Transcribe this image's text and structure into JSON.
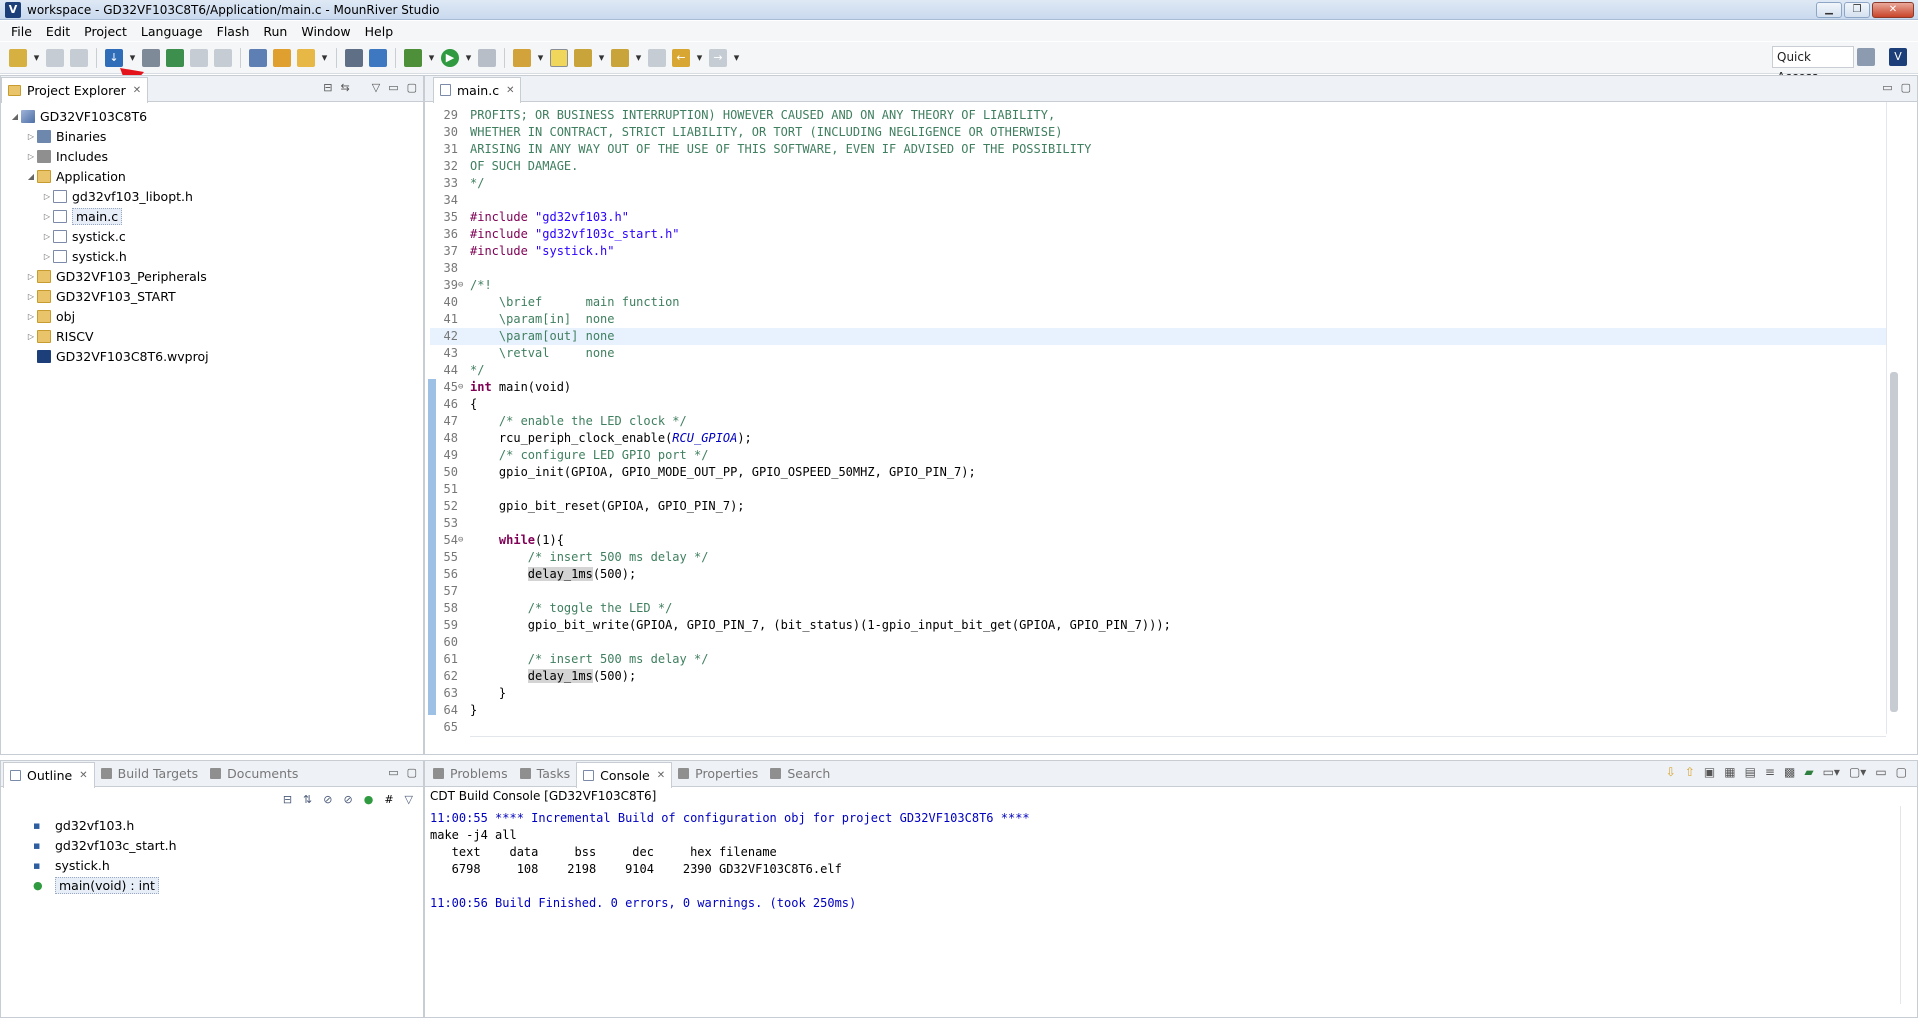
{
  "window": {
    "title": "workspace - GD32VF103C8T6/Application/main.c - MounRiver Studio"
  },
  "menu": [
    "File",
    "Edit",
    "Project",
    "Language",
    "Flash",
    "Run",
    "Window",
    "Help"
  ],
  "toolbar": {
    "quick_access": "Quick Access"
  },
  "project_explorer": {
    "title": "Project Explorer",
    "nodes": [
      {
        "label": "GD32VF103C8T6",
        "depth": 0,
        "twisty": "open",
        "icon": "project-icon"
      },
      {
        "label": "Binaries",
        "depth": 1,
        "twisty": "closed",
        "icon": "binaries-icon"
      },
      {
        "label": "Includes",
        "depth": 1,
        "twisty": "closed",
        "icon": "includes-icon"
      },
      {
        "label": "Application",
        "depth": 1,
        "twisty": "open",
        "icon": "folder-icon"
      },
      {
        "label": "gd32vf103_libopt.h",
        "depth": 2,
        "twisty": "closed",
        "icon": "header-file-icon"
      },
      {
        "label": "main.c",
        "depth": 2,
        "twisty": "closed",
        "icon": "c-file-icon",
        "selected": true
      },
      {
        "label": "systick.c",
        "depth": 2,
        "twisty": "closed",
        "icon": "c-file-icon"
      },
      {
        "label": "systick.h",
        "depth": 2,
        "twisty": "closed",
        "icon": "header-file-icon"
      },
      {
        "label": "GD32VF103_Peripherals",
        "depth": 1,
        "twisty": "closed",
        "icon": "folder-icon"
      },
      {
        "label": "GD32VF103_START",
        "depth": 1,
        "twisty": "closed",
        "icon": "folder-icon"
      },
      {
        "label": "obj",
        "depth": 1,
        "twisty": "closed",
        "icon": "folder-icon"
      },
      {
        "label": "RISCV",
        "depth": 1,
        "twisty": "closed",
        "icon": "folder-icon"
      },
      {
        "label": "GD32VF103C8T6.wvproj",
        "depth": 1,
        "twisty": "none",
        "icon": "wvproj-file-icon"
      }
    ]
  },
  "editor": {
    "tab": "main.c",
    "lines": [
      {
        "n": "29",
        "fold": "",
        "text": "PROFITS; OR BUSINESS INTERRUPTION) HOWEVER CAUSED AND ON ANY THEORY OF LIABILITY,",
        "cls": "cm"
      },
      {
        "n": "30",
        "fold": "",
        "text": "WHETHER IN CONTRACT, STRICT LIABILITY, OR TORT (INCLUDING NEGLIGENCE OR OTHERWISE)",
        "cls": "cm"
      },
      {
        "n": "31",
        "fold": "",
        "text": "ARISING IN ANY WAY OUT OF THE USE OF THIS SOFTWARE, EVEN IF ADVISED OF THE POSSIBILITY",
        "cls": "cm"
      },
      {
        "n": "32",
        "fold": "",
        "text": "OF SUCH DAMAGE.",
        "cls": "cm"
      },
      {
        "n": "33",
        "fold": "",
        "text": "*/",
        "cls": "cm"
      },
      {
        "n": "34",
        "fold": "",
        "text": "",
        "cls": ""
      },
      {
        "n": "35",
        "fold": "",
        "pre": "#include ",
        "str": "\"gd32vf103.h\""
      },
      {
        "n": "36",
        "fold": "",
        "pre": "#include ",
        "str": "\"gd32vf103c_start.h\""
      },
      {
        "n": "37",
        "fold": "",
        "pre": "#include ",
        "str": "\"systick.h\""
      },
      {
        "n": "38",
        "fold": "",
        "text": "",
        "cls": ""
      },
      {
        "n": "39",
        "fold": "⊖",
        "text": "/*!",
        "cls": "cm"
      },
      {
        "n": "40",
        "fold": "",
        "text": "    \\brief      main function",
        "cls": "cm"
      },
      {
        "n": "41",
        "fold": "",
        "text": "    \\param[in]  none",
        "cls": "cm"
      },
      {
        "n": "42",
        "fold": "",
        "text": "    \\param[out] none",
        "cls": "cm",
        "hl": true
      },
      {
        "n": "43",
        "fold": "",
        "text": "    \\retval     none",
        "cls": "cm"
      },
      {
        "n": "44",
        "fold": "",
        "text": "*/",
        "cls": "cm"
      },
      {
        "n": "45",
        "fold": "⊖",
        "kw": "int",
        "rest": " main(void)"
      },
      {
        "n": "46",
        "fold": "",
        "text": "{",
        "cls": ""
      },
      {
        "n": "47",
        "fold": "",
        "text": "    /* enable the LED clock */",
        "cls": "cm"
      },
      {
        "n": "48",
        "fold": "",
        "pre2": "    rcu_periph_clock_enable(",
        "macro": "RCU_GPIOA",
        "post": ");"
      },
      {
        "n": "49",
        "fold": "",
        "text": "    /* configure LED GPIO port */",
        "cls": "cm"
      },
      {
        "n": "50",
        "fold": "",
        "text": "    gpio_init(GPIOA, GPIO_MODE_OUT_PP, GPIO_OSPEED_50MHZ, GPIO_PIN_7);",
        "cls": ""
      },
      {
        "n": "51",
        "fold": "",
        "text": "",
        "cls": ""
      },
      {
        "n": "52",
        "fold": "",
        "text": "    gpio_bit_reset(GPIOA, GPIO_PIN_7);",
        "cls": ""
      },
      {
        "n": "53",
        "fold": "",
        "text": "",
        "cls": ""
      },
      {
        "n": "54",
        "fold": "⊖",
        "kwpre": "    ",
        "kw": "while",
        "rest": "(1){"
      },
      {
        "n": "55",
        "fold": "",
        "text": "        /* insert 500 ms delay */",
        "cls": "cm"
      },
      {
        "n": "56",
        "fold": "",
        "occpre": "        ",
        "occ": "delay_1ms",
        "post": "(500);"
      },
      {
        "n": "57",
        "fold": "",
        "text": "",
        "cls": ""
      },
      {
        "n": "58",
        "fold": "",
        "text": "        /* toggle the LED */",
        "cls": "cm"
      },
      {
        "n": "59",
        "fold": "",
        "text": "        gpio_bit_write(GPIOA, GPIO_PIN_7, (bit_status)(1-gpio_input_bit_get(GPIOA, GPIO_PIN_7)));",
        "cls": ""
      },
      {
        "n": "60",
        "fold": "",
        "text": "",
        "cls": ""
      },
      {
        "n": "61",
        "fold": "",
        "text": "        /* insert 500 ms delay */",
        "cls": "cm"
      },
      {
        "n": "62",
        "fold": "",
        "occpre": "        ",
        "occ": "delay_1ms",
        "post": "(500);"
      },
      {
        "n": "63",
        "fold": "",
        "text": "    }",
        "cls": ""
      },
      {
        "n": "64",
        "fold": "",
        "text": "}",
        "cls": ""
      },
      {
        "n": "65",
        "fold": "",
        "text": "",
        "cls": ""
      }
    ]
  },
  "outline": {
    "tabs": [
      {
        "label": "Outline",
        "active": true
      },
      {
        "label": "Build Targets"
      },
      {
        "label": "Documents"
      }
    ],
    "items": [
      {
        "label": "gd32vf103.h",
        "icon": "include-icon"
      },
      {
        "label": "gd32vf103c_start.h",
        "icon": "include-icon"
      },
      {
        "label": "systick.h",
        "icon": "include-icon"
      },
      {
        "label": "main(void) : int",
        "icon": "function-icon",
        "selected": true
      }
    ]
  },
  "bottom": {
    "tabs": [
      {
        "label": "Problems"
      },
      {
        "label": "Tasks"
      },
      {
        "label": "Console",
        "active": true
      },
      {
        "label": "Properties"
      },
      {
        "label": "Search"
      }
    ],
    "console_title": "CDT Build Console [GD32VF103C8T6]",
    "lines": [
      {
        "text": "11:00:55 **** Incremental Build of configuration obj for project GD32VF103C8T6 ****",
        "blue": true
      },
      {
        "text": "make -j4 all"
      },
      {
        "text": "   text    data     bss     dec     hex filename"
      },
      {
        "text": "   6798     108    2198    9104    2390 GD32VF103C8T6.elf"
      },
      {
        "text": ""
      },
      {
        "text": "11:00:56 Build Finished. 0 errors, 0 warnings. (took 250ms)",
        "blue": true
      }
    ]
  }
}
